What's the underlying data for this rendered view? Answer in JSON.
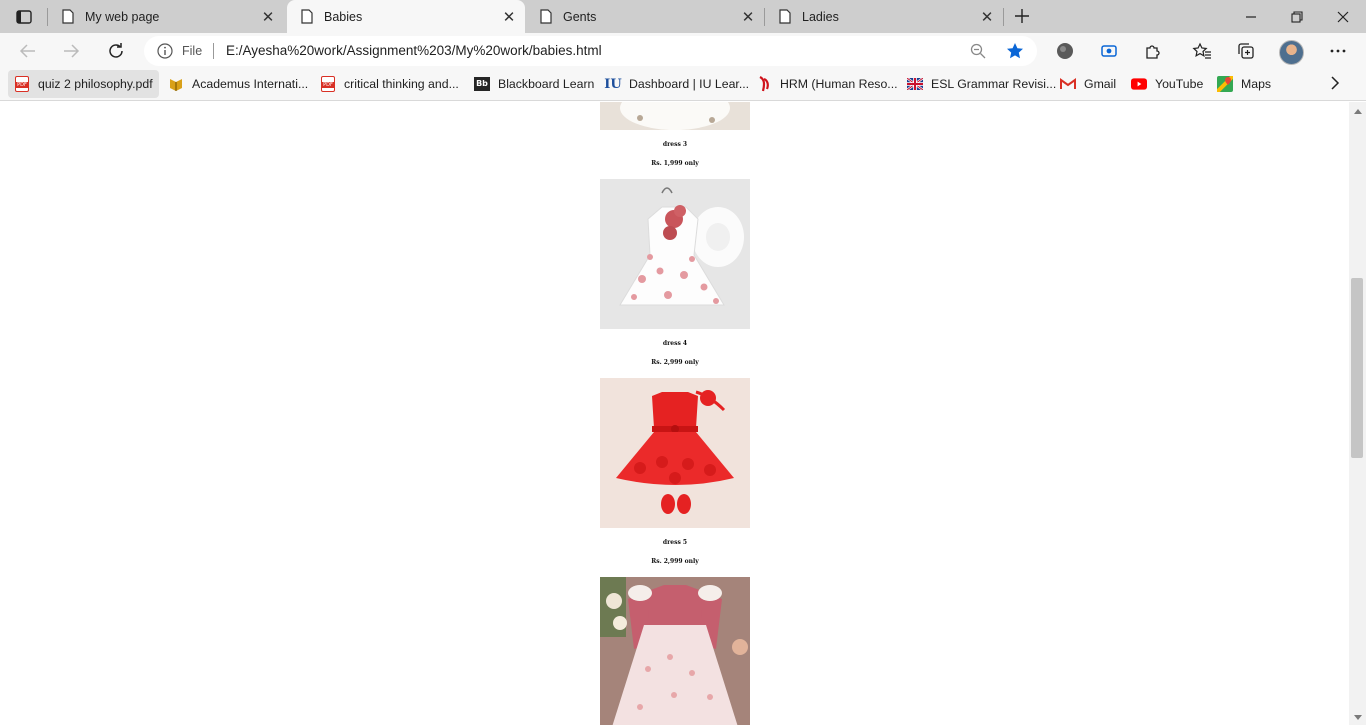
{
  "tabs": [
    {
      "title": "My web page",
      "active": false
    },
    {
      "title": "Babies",
      "active": true
    },
    {
      "title": "Gents",
      "active": false
    },
    {
      "title": "Ladies",
      "active": false
    }
  ],
  "toolbar": {
    "scheme_label": "File",
    "url": "E:/Ayesha%20work/Assignment%203/My%20work/babies.html"
  },
  "bookmarks": [
    {
      "label": "quiz 2 philosophy.pdf",
      "icon": "pdf-icon"
    },
    {
      "label": "Academus Internati...",
      "icon": "academus-icon"
    },
    {
      "label": "critical thinking and...",
      "icon": "pdf-icon"
    },
    {
      "label": "Blackboard Learn",
      "icon": "blackboard-icon",
      "icon_text": "Bb"
    },
    {
      "label": "Dashboard | IU Lear...",
      "icon": "iu-icon",
      "icon_text": "IU"
    },
    {
      "label": "HRM (Human Reso...",
      "icon": "hrm-icon"
    },
    {
      "label": "ESL Grammar Revisi...",
      "icon": "uk-flag-icon"
    },
    {
      "label": "Gmail",
      "icon": "gmail-icon"
    },
    {
      "label": "YouTube",
      "icon": "youtube-icon"
    },
    {
      "label": "Maps",
      "icon": "maps-icon"
    }
  ],
  "products": [
    {
      "name": "dress 3",
      "price": "Rs. 1,999 only"
    },
    {
      "name": "dress 4",
      "price": "Rs. 2,999 only"
    },
    {
      "name": "dress 5",
      "price": "Rs. 2,999 only"
    }
  ],
  "colors": {
    "tab_strip": "#cecece",
    "toolbar": "#f7f7f7",
    "accent_star": "#0a66d6",
    "red_dress": "#e52222",
    "pink_dress": "#c55f6e"
  }
}
